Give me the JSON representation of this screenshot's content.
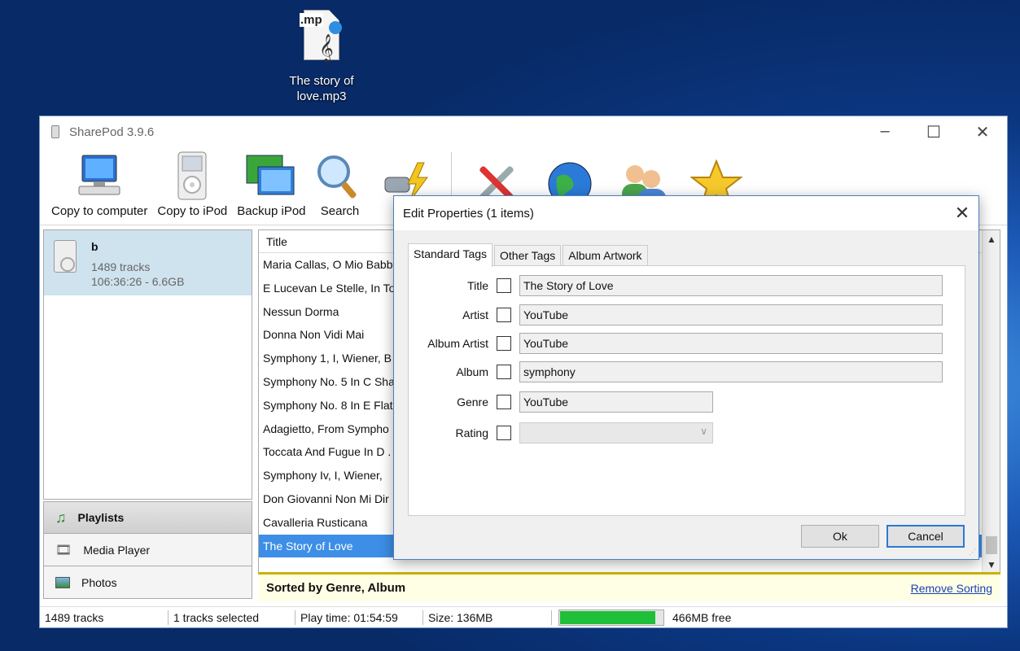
{
  "desktop": {
    "icon_label": "The story of love.mp3",
    "icon_badge": ".mp"
  },
  "window": {
    "title": "SharePod 3.9.6"
  },
  "toolbar": {
    "copy_to_computer": "Copy to computer",
    "copy_to_ipod": "Copy to iPod",
    "backup_ipod": "Backup iPod",
    "search": "Search"
  },
  "device": {
    "name": "b",
    "tracks": "1489 tracks",
    "info": "106:36:26 - 6.6GB"
  },
  "nav": {
    "playlists": "Playlists",
    "media_player": "Media Player",
    "photos": "Photos"
  },
  "tracklist": {
    "column_title": "Title",
    "rows": [
      "Maria Callas, O Mio Babbi...",
      "E Lucevan Le Stelle, In To",
      "Nessun Dorma",
      "Donna Non Vidi Mai",
      "Symphony 1, I, Wiener, B",
      "Symphony No. 5 In C Sha",
      "Symphony No. 8 In E Flat",
      "Adagietto, From Sympho",
      "Toccata And Fugue In D .",
      "Symphony Iv, I, Wiener,",
      "Don Giovanni Non Mi Dir",
      "Cavalleria Rusticana",
      "The Story of Love"
    ],
    "selected_index": 12
  },
  "sortbar": {
    "text": "Sorted by  Genre, Album",
    "remove": "Remove Sorting"
  },
  "status": {
    "tracks": "1489 tracks",
    "selected": "1 tracks selected",
    "playtime": "Play time: 01:54:59",
    "size": "Size: 136MB",
    "usage_fraction": 0.93,
    "free": "466MB free"
  },
  "dialog": {
    "title": "Edit Properties (1 items)",
    "tabs": [
      "Standard Tags",
      "Other Tags",
      "Album Artwork"
    ],
    "active_tab": 0,
    "labels": {
      "title": "Title",
      "artist": "Artist",
      "album_artist": "Album Artist",
      "album": "Album",
      "genre": "Genre",
      "rating": "Rating"
    },
    "values": {
      "title": "The Story of Love",
      "artist": "YouTube",
      "album_artist": "YouTube",
      "album": "symphony",
      "genre": "YouTube",
      "rating": ""
    },
    "ok": "Ok",
    "cancel": "Cancel"
  },
  "colors": {
    "selection": "#3d8ee6",
    "progress": "#1fbf3a",
    "sortbar_accent": "#c8b400",
    "link": "#1a3fb5"
  }
}
